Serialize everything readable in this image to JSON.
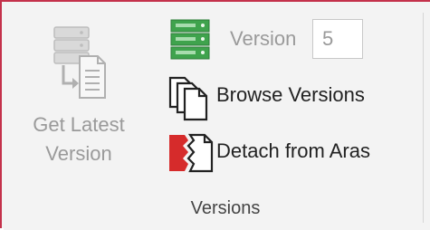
{
  "ribbon": {
    "get_latest": {
      "label_line1": "Get Latest",
      "label_line2": "Version",
      "icon": "get-latest-version-icon",
      "enabled": false
    },
    "version": {
      "label": "Version",
      "value": "5",
      "icon": "version-stack-icon",
      "enabled": false
    },
    "browse_versions": {
      "label": "Browse Versions",
      "icon": "browse-versions-icon"
    },
    "detach": {
      "label": "Detach from Aras",
      "icon": "detach-icon"
    },
    "group_label": "Versions"
  },
  "colors": {
    "ribbon_bg": "#f3f3f3",
    "border_accent": "#c4314b",
    "disabled_text": "#9a9a9a",
    "text": "#222222",
    "version_icon_green": "#3fa34d",
    "detach_red": "#d62b2b"
  }
}
